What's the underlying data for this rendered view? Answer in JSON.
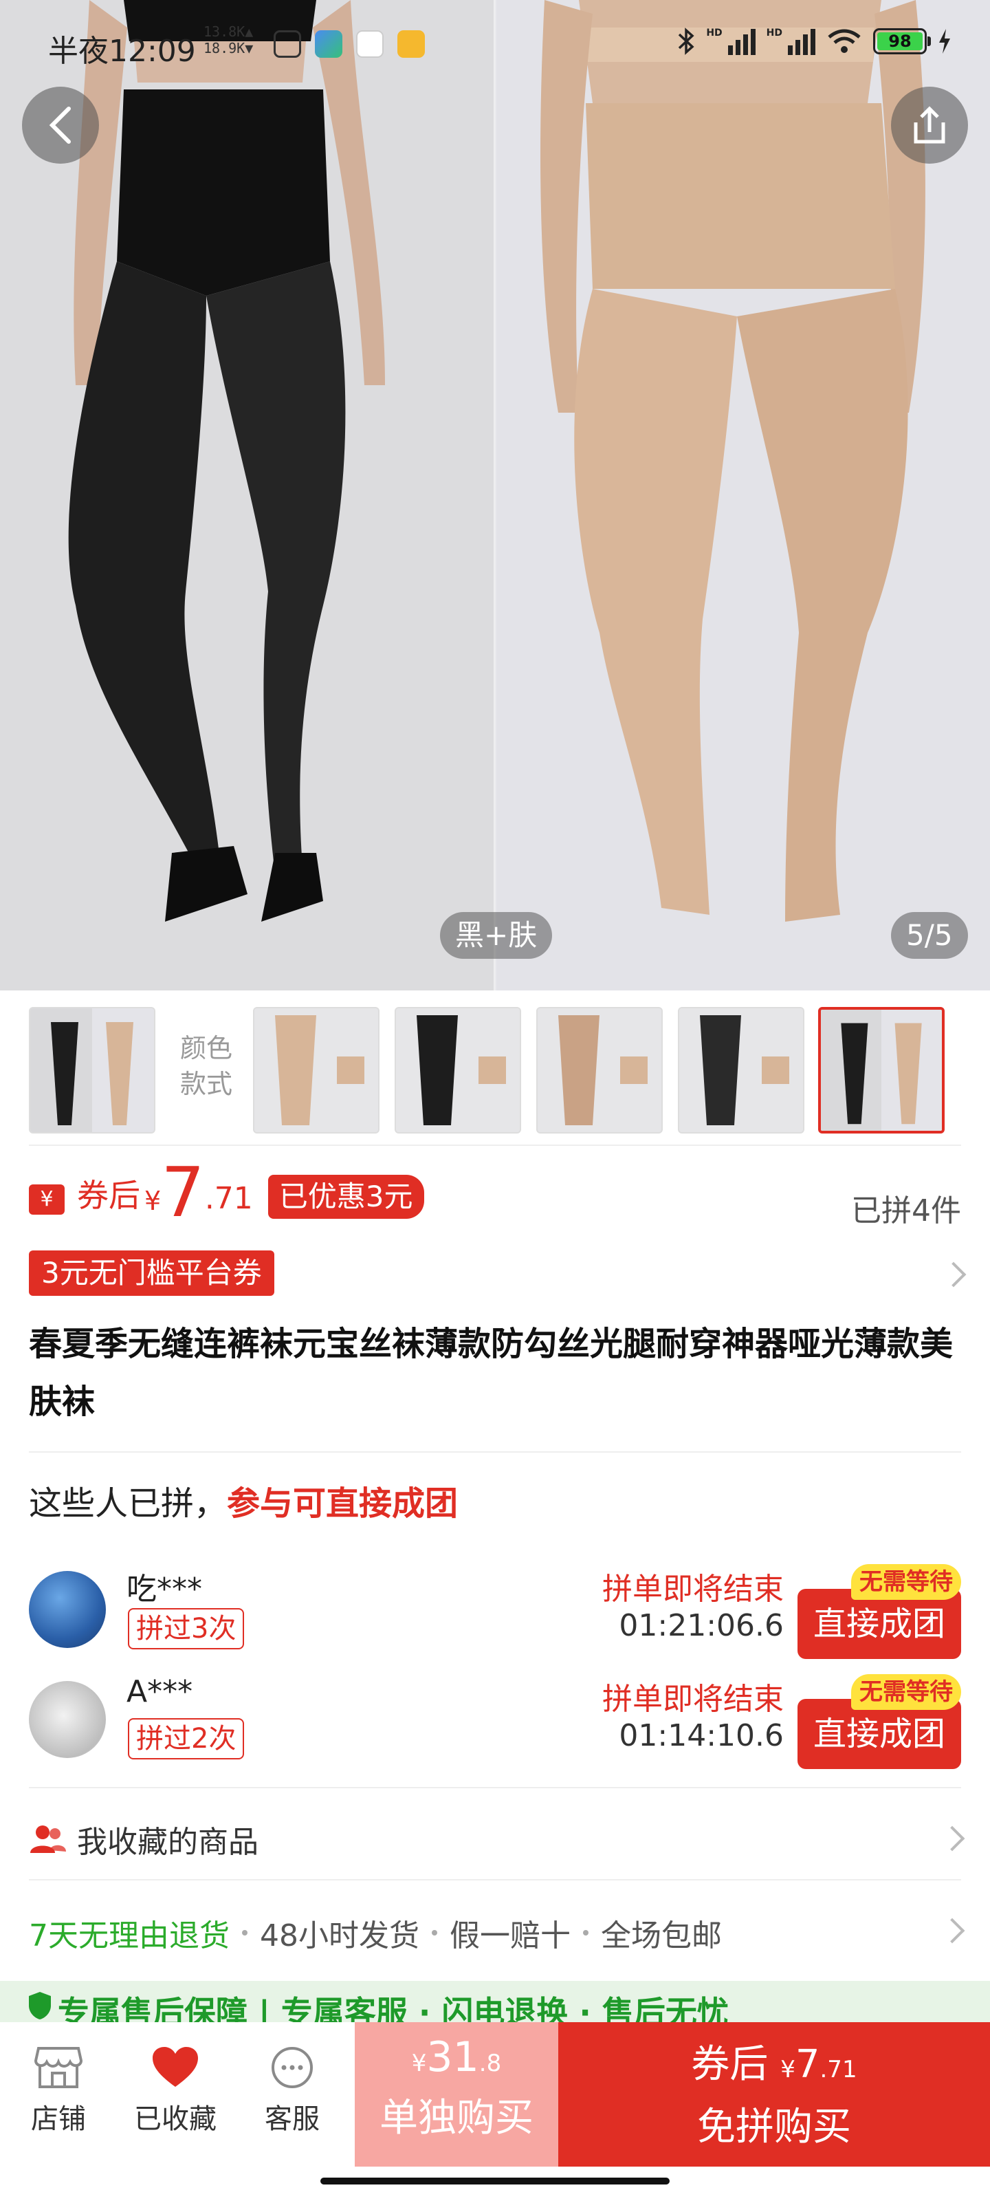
{
  "status_bar": {
    "time": "半夜12:09",
    "speed_up": "13.8K▲",
    "speed_down": "18.9K▼",
    "hd1": "HD",
    "hd2": "HD",
    "battery": "98"
  },
  "gallery": {
    "variant_label": "黑+肤",
    "page_indicator": "5/5"
  },
  "thumbnails": {
    "side_label_line1": "颜色",
    "side_label_line2": "款式",
    "count": 6,
    "selected_index": 5
  },
  "price": {
    "icon_text": "¥",
    "label": "券后",
    "currency": "¥",
    "integer": "7",
    "decimal": ".71",
    "discount_tag": "已优惠3元",
    "sold": "已拼4件",
    "platform_coupon": "3元无门槛平台券"
  },
  "product": {
    "title": "春夏季无缝连裤袜元宝丝袜薄款防勾丝光腿耐穿神器哑光薄款美肤袜"
  },
  "group_buy": {
    "heading": "这些人已拼，",
    "heading_highlight": "参与可直接成团",
    "rows": [
      {
        "user": "吃***",
        "joined": "拼过3次",
        "ending": "拼单即将结束",
        "countdown": "01:21:06.6",
        "button": "直接成团",
        "badge": "无需等待"
      },
      {
        "user": "A***",
        "joined": "拼过2次",
        "ending": "拼单即将结束",
        "countdown": "01:14:10.6",
        "button": "直接成团",
        "badge": "无需等待"
      }
    ]
  },
  "favorites": {
    "label": "我收藏的商品"
  },
  "services": {
    "first": "7天无理由退货",
    "second": "48小时发货",
    "third": "假一赔十",
    "fourth": "全场包邮"
  },
  "promise_strip": {
    "text": "专属售后保障 | 专属客服 · 闪电退换 · 售后无忧"
  },
  "bottom_bar": {
    "shop": "店铺",
    "favorited": "已收藏",
    "service": "客服",
    "alone_currency": "¥",
    "alone_int": "31",
    "alone_dec": ".8",
    "alone_label": "单独购买",
    "direct_prefix": "券后",
    "direct_currency": "¥",
    "direct_int": "7",
    "direct_dec": ".71",
    "direct_label": "免拼购买"
  },
  "colors": {
    "accent": "#e02e24",
    "green": "#2bab2b",
    "badge_yellow": "#ffe23d"
  }
}
